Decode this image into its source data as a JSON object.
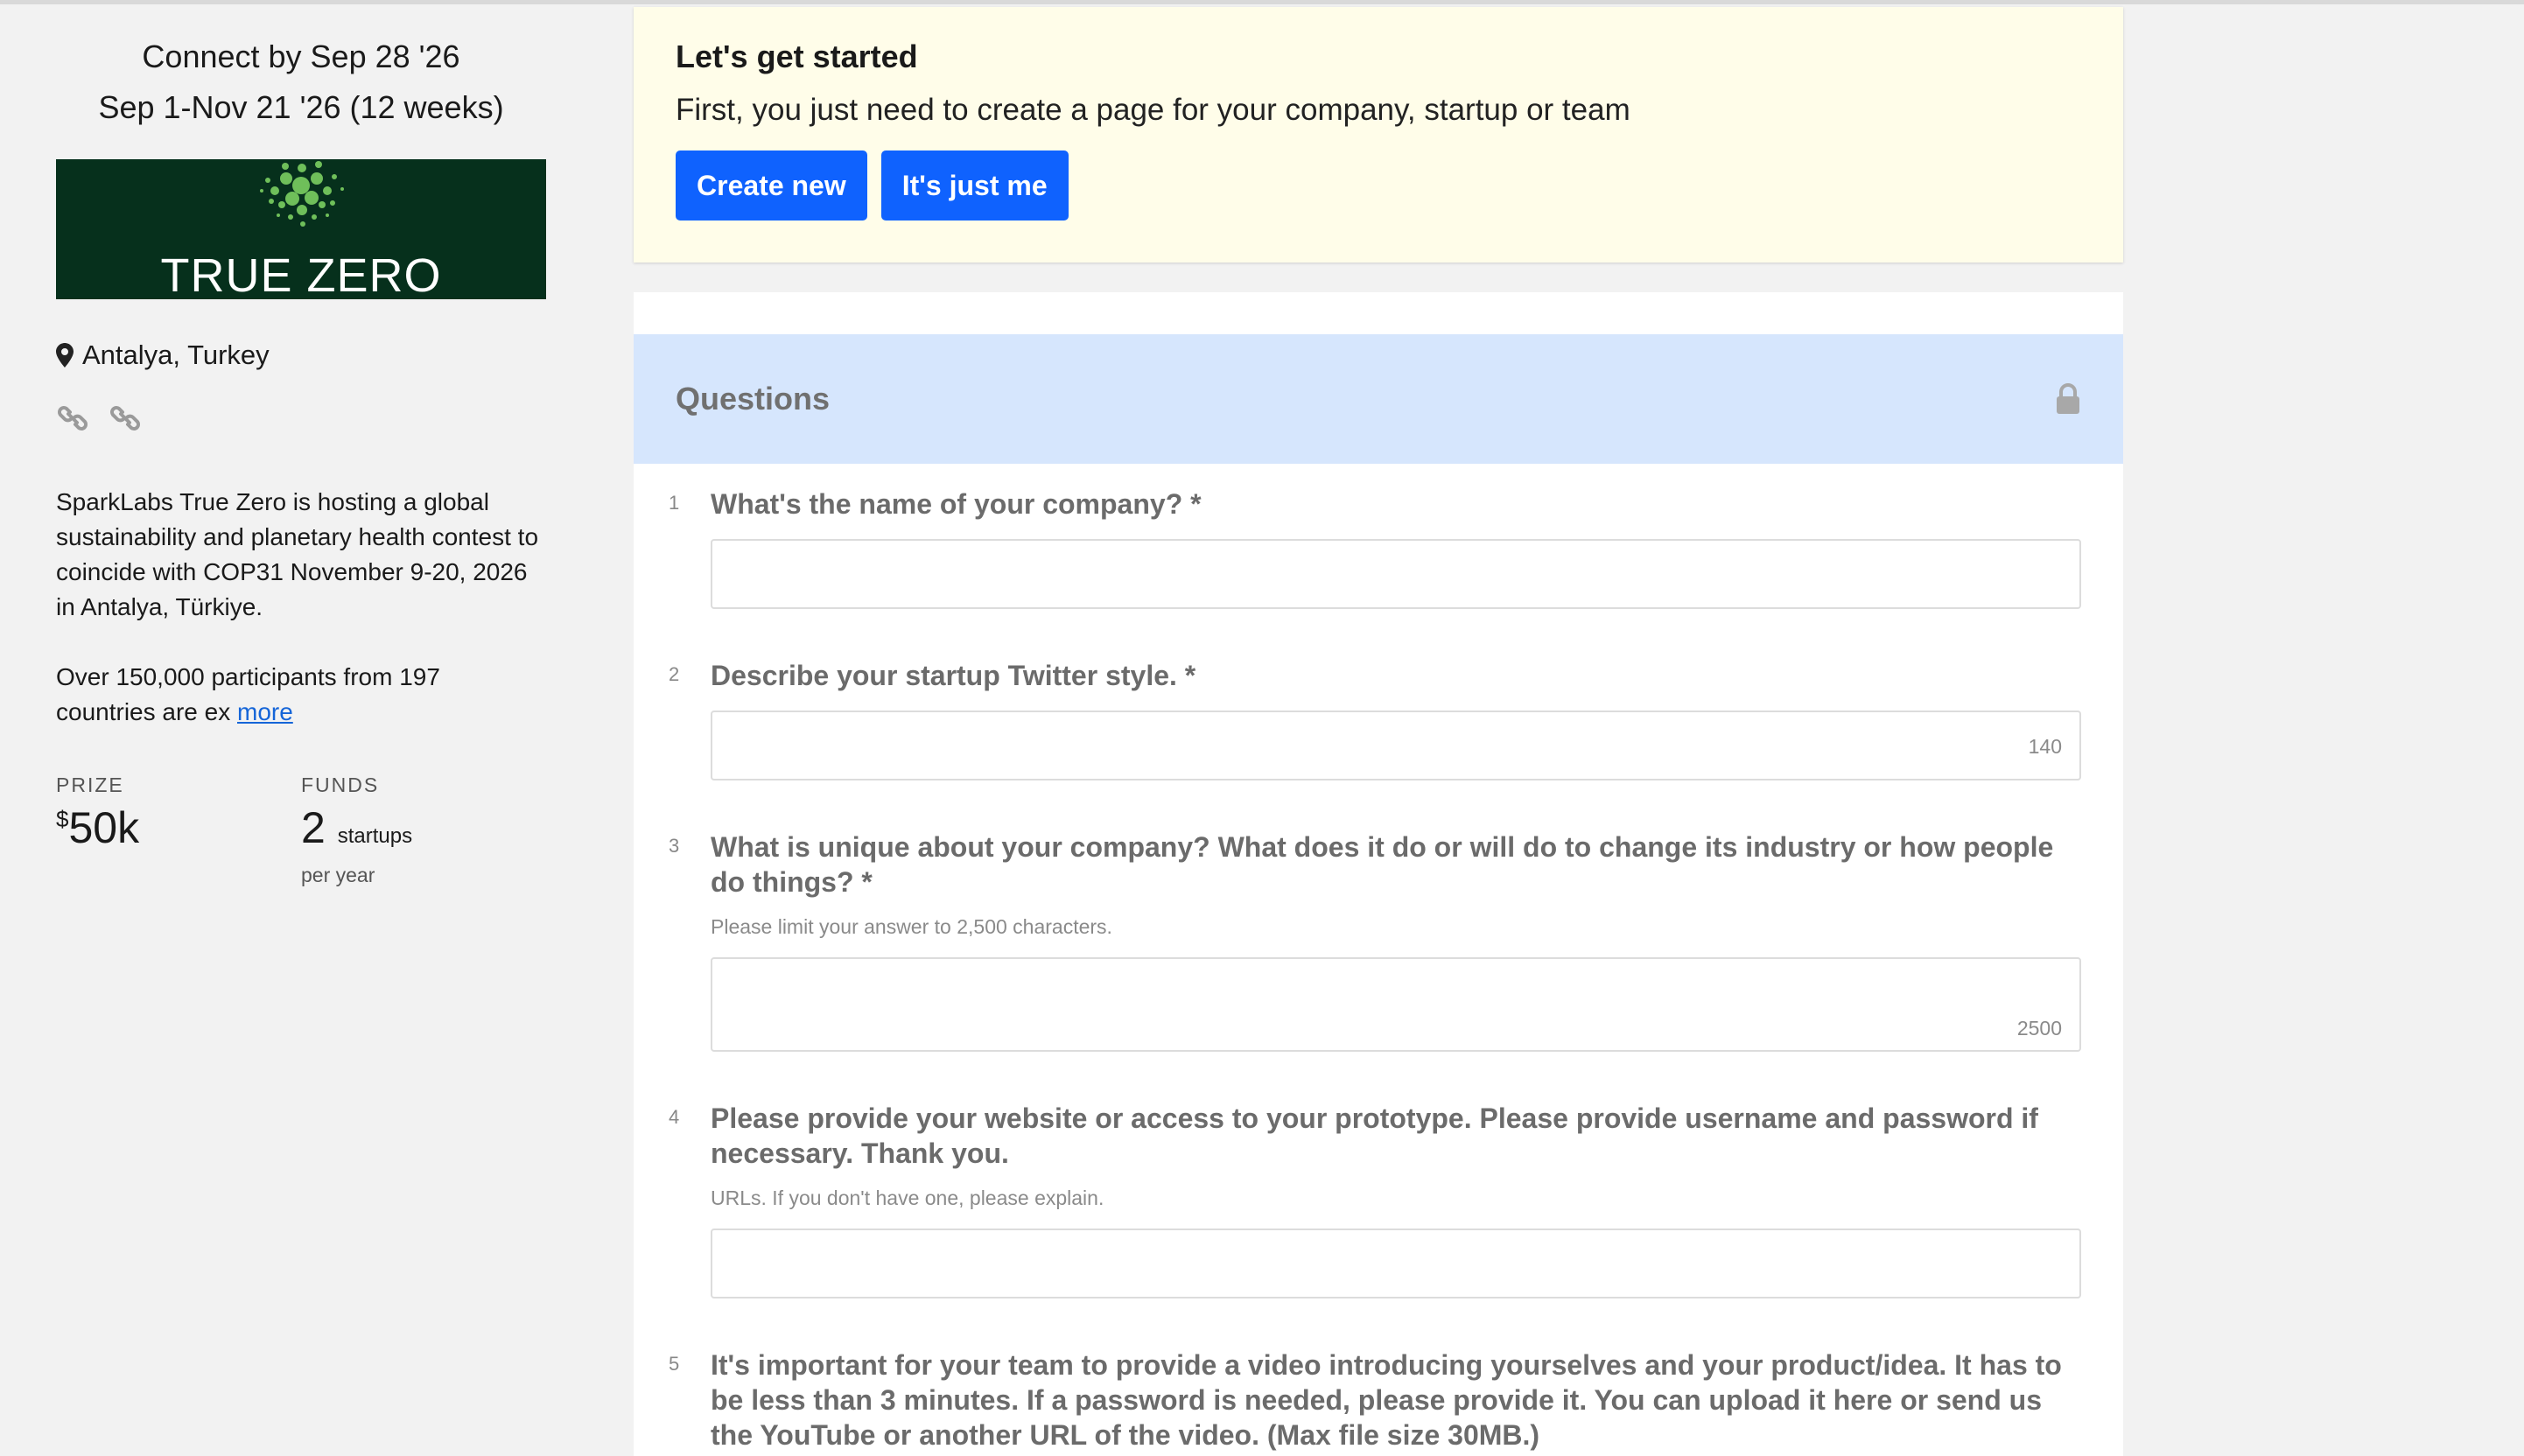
{
  "sidebar": {
    "connect_line": "Connect by Sep 28 '26",
    "dates_line": "Sep 1-Nov 21 '26 (12 weeks)",
    "banner_text": "TRUE ZERO",
    "location": "Antalya, Turkey",
    "description_1": "SparkLabs True Zero is hosting a global sustainability and planetary health contest to coincide with COP31 November 9-20, 2026 in Antalya, Türkiye.",
    "description_2": "Over 150,000 participants from 197 countries are ex",
    "more_link": "more",
    "prize": {
      "label": "PRIZE",
      "currency": "$",
      "value": "50k"
    },
    "funds": {
      "label": "FUNDS",
      "value": "2",
      "unit": "startups",
      "sub": "per year"
    }
  },
  "started": {
    "title": "Let's get started",
    "text": "First, you just need to create a page for your company, startup or team",
    "create_label": "Create new",
    "just_me_label": "It's just me"
  },
  "questions": {
    "header": "Questions",
    "items": [
      {
        "num": "1",
        "text": "What's the name of your company? *"
      },
      {
        "num": "2",
        "text": "Describe your startup Twitter style. *",
        "count": "140"
      },
      {
        "num": "3",
        "text": "What is unique about your company? What does it do or will do to change its industry or how people do things? *",
        "help": "Please limit your answer to 2,500 characters.",
        "count": "2500"
      },
      {
        "num": "4",
        "text": "Please provide your website or access to your prototype. Please provide username and password if necessary. Thank you.",
        "help": "URLs.  If you don't have one, please explain."
      },
      {
        "num": "5",
        "text": "It's important for your team to provide a video introducing yourselves and your product/idea. It has to be less than 3 minutes. If a password is needed, please provide it. You can upload it here or send us the YouTube or another URL of the video. (Max file size 30MB.)"
      }
    ]
  },
  "colors": {
    "primary_button": "#0f62fe",
    "banner_bg": "#06301c",
    "started_bg": "#fffde9",
    "questions_header_bg": "#d6e6fd",
    "link": "#1565d8"
  },
  "icons": [
    "map-pin-icon",
    "link-icon",
    "lock-icon"
  ]
}
